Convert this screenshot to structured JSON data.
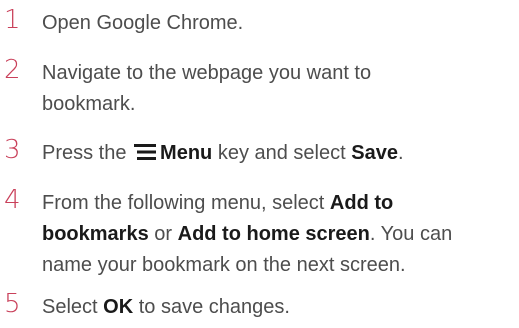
{
  "steps": [
    {
      "number": "1",
      "text": "Open Google Chrome."
    },
    {
      "number": "2",
      "line1": "Navigate to the webpage you want to",
      "line2": "bookmark."
    },
    {
      "number": "3",
      "prefix": "Press the ",
      "icon": "menu-icon",
      "menu_label": "Menu",
      "middle": " key and select ",
      "save_label": "Save",
      "suffix": "."
    },
    {
      "number": "4",
      "line1_prefix": "From the following menu, select ",
      "add_to": "Add to",
      "bookmarks": "bookmarks",
      "or": " or ",
      "add_home": "Add to home screen",
      "line2_suffix": ". You can",
      "line3": "name your bookmark on the next screen."
    },
    {
      "number": "5",
      "prefix": "Select ",
      "ok_label": "OK",
      "suffix": " to save changes."
    }
  ],
  "colors": {
    "step_number": "#c9405a",
    "body_text": "#4d4d4d",
    "bold_text": "#1a1a1a"
  }
}
